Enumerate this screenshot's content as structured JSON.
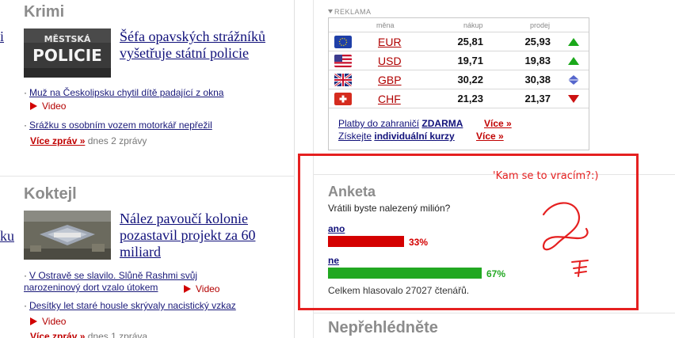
{
  "left": {
    "cut_links": [
      "i",
      "ku"
    ],
    "krimi": {
      "title": "Krimi",
      "thumb_text": [
        "MĚSTSKÁ",
        "POLICIE"
      ],
      "headline_lines": [
        "Šéfa opavských strážníků",
        "vyšetřuje státní policie"
      ],
      "items": [
        {
          "text": "Muž na Českolipsku chytil dítě padající z okna",
          "video": "Video"
        },
        {
          "text": "Srážku s osobním vozem motorkář nepřežil"
        }
      ],
      "more_label": "Více zpráv »",
      "more_count": "dnes 2 zprávy"
    },
    "koktejl": {
      "title": "Koktejl",
      "headline_lines": [
        "Nález pavoučí kolonie",
        "pozastavil projekt za 60",
        "miliard"
      ],
      "items": [
        {
          "lines": [
            "V Ostravě se slavilo. Slůně Rashmi svůj",
            "narozeninový dort vzalo útokem"
          ],
          "video": "Video"
        },
        {
          "lines": [
            "Desítky let staré housle skrývaly nacistický vzkaz"
          ],
          "video": "Video"
        }
      ],
      "more_label": "Více zpráv »",
      "more_count": "dnes 1 zpráva"
    }
  },
  "right": {
    "reklama": "REKLAMA",
    "fx": {
      "col_headers": {
        "currency": "měna",
        "buy": "nákup",
        "sell": "prodej"
      },
      "rows": [
        {
          "code": "EUR",
          "buy": "25,81",
          "sell": "25,93",
          "trend": "up",
          "flag": "eu-flag-icon"
        },
        {
          "code": "USD",
          "buy": "19,71",
          "sell": "19,83",
          "trend": "up",
          "flag": "us-flag-icon"
        },
        {
          "code": "GBP",
          "buy": "30,22",
          "sell": "30,38",
          "trend": "flat",
          "flag": "uk-flag-icon"
        },
        {
          "code": "CHF",
          "buy": "21,23",
          "sell": "21,37",
          "trend": "down",
          "flag": "ch-flag-icon"
        }
      ],
      "links": [
        {
          "text": "Platby do zahraničí",
          "bold": "ZDARMA",
          "more": "Více »"
        },
        {
          "text": "Získejte",
          "bold": "individuální kurzy",
          "more": "Více »"
        }
      ],
      "colors": {
        "up": "#1aa81a",
        "down": "#cc1111",
        "flat": "#5566cc"
      }
    },
    "poll": {
      "title": "Anketa",
      "question": "Vrátili byste nalezený milión?",
      "options": [
        {
          "label": "ano",
          "percent": 33,
          "percent_label": "33%",
          "color": "#d40000"
        },
        {
          "label": "ne",
          "percent": 67,
          "percent_label": "67%",
          "color": "#22a822"
        }
      ],
      "total": "Celkem hlasovalo 27027 čtenářů."
    },
    "next_title": "Nepřehlédněte"
  },
  "annotation": {
    "text": "'Kam se to vracím?:)",
    "color": "#e52020"
  }
}
